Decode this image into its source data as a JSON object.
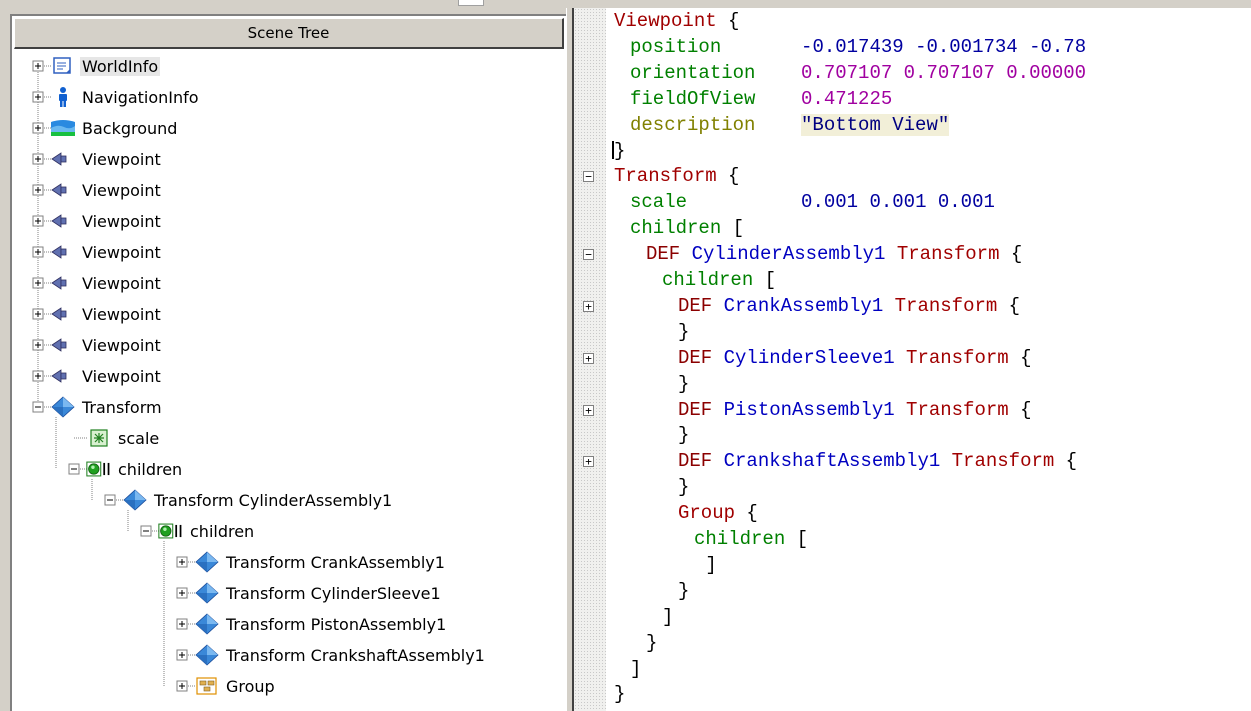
{
  "scene_tree": {
    "title": "Scene Tree",
    "nodes": [
      {
        "label": "WorldInfo",
        "icon": "worldinfo-icon",
        "level": 0,
        "expander": "+",
        "selected": true
      },
      {
        "label": "NavigationInfo",
        "icon": "navigationinfo-icon",
        "level": 0,
        "expander": "+"
      },
      {
        "label": "Background",
        "icon": "background-icon",
        "level": 0,
        "expander": "+"
      },
      {
        "label": "Viewpoint",
        "icon": "viewpoint-icon",
        "level": 0,
        "expander": "+"
      },
      {
        "label": "Viewpoint",
        "icon": "viewpoint-icon",
        "level": 0,
        "expander": "+"
      },
      {
        "label": "Viewpoint",
        "icon": "viewpoint-icon",
        "level": 0,
        "expander": "+"
      },
      {
        "label": "Viewpoint",
        "icon": "viewpoint-icon",
        "level": 0,
        "expander": "+"
      },
      {
        "label": "Viewpoint",
        "icon": "viewpoint-icon",
        "level": 0,
        "expander": "+"
      },
      {
        "label": "Viewpoint",
        "icon": "viewpoint-icon",
        "level": 0,
        "expander": "+"
      },
      {
        "label": "Viewpoint",
        "icon": "viewpoint-icon",
        "level": 0,
        "expander": "+"
      },
      {
        "label": "Viewpoint",
        "icon": "viewpoint-icon",
        "level": 0,
        "expander": "+"
      },
      {
        "label": "Transform",
        "icon": "transform-icon",
        "level": 0,
        "expander": "-"
      },
      {
        "label": "scale",
        "icon": "field-icon",
        "level": 1,
        "expander": ""
      },
      {
        "label": "children",
        "icon": "children-icon",
        "level": 1,
        "expander": "-"
      },
      {
        "label": "Transform CylinderAssembly1",
        "icon": "transform-icon",
        "level": 2,
        "expander": "-"
      },
      {
        "label": "children",
        "icon": "children-icon",
        "level": 3,
        "expander": "-"
      },
      {
        "label": "Transform CrankAssembly1",
        "icon": "transform-icon",
        "level": 4,
        "expander": "+"
      },
      {
        "label": "Transform CylinderSleeve1",
        "icon": "transform-icon",
        "level": 4,
        "expander": "+"
      },
      {
        "label": "Transform PistonAssembly1",
        "icon": "transform-icon",
        "level": 4,
        "expander": "+"
      },
      {
        "label": "Transform CrankshaftAssembly1",
        "icon": "transform-icon",
        "level": 4,
        "expander": "+"
      },
      {
        "label": "Group",
        "icon": "group-icon",
        "level": 4,
        "expander": "+"
      }
    ]
  },
  "editor": {
    "lines": [
      {
        "indent": 0,
        "fold": "",
        "tokens": [
          [
            "node",
            "Viewpoint"
          ],
          [
            "punc",
            " {"
          ]
        ]
      },
      {
        "indent": 1,
        "fold": "",
        "tokens": [
          [
            "field",
            "position"
          ],
          [
            "punc",
            "       "
          ],
          [
            "num",
            "-0.017439 -0.001734 -0.78"
          ]
        ]
      },
      {
        "indent": 1,
        "fold": "",
        "tokens": [
          [
            "field",
            "orientation"
          ],
          [
            "punc",
            "    "
          ],
          [
            "num2",
            "0.707107 0.707107 0.00000"
          ]
        ]
      },
      {
        "indent": 1,
        "fold": "",
        "tokens": [
          [
            "field",
            "fieldOfView"
          ],
          [
            "punc",
            "    "
          ],
          [
            "num2",
            "0.471225"
          ]
        ]
      },
      {
        "indent": 1,
        "fold": "",
        "tokens": [
          [
            "fieldy",
            "description"
          ],
          [
            "punc",
            "    "
          ],
          [
            "str",
            "\"Bottom View\""
          ]
        ]
      },
      {
        "indent": 0,
        "fold": "",
        "tokens": [
          [
            "punc",
            "}"
          ]
        ],
        "caret": true
      },
      {
        "indent": 0,
        "fold": "-",
        "tokens": [
          [
            "node",
            "Transform"
          ],
          [
            "punc",
            " {"
          ]
        ]
      },
      {
        "indent": 1,
        "fold": "",
        "tokens": [
          [
            "field",
            "scale"
          ],
          [
            "punc",
            "          "
          ],
          [
            "num",
            "0.001 0.001 0.001"
          ]
        ]
      },
      {
        "indent": 1,
        "fold": "",
        "tokens": [
          [
            "field",
            "children"
          ],
          [
            "punc",
            " ["
          ]
        ]
      },
      {
        "indent": 2,
        "fold": "-",
        "tokens": [
          [
            "def",
            "DEF "
          ],
          [
            "name",
            "CylinderAssembly1"
          ],
          [
            "punc",
            " "
          ],
          [
            "node",
            "Transform"
          ],
          [
            "punc",
            " {"
          ]
        ]
      },
      {
        "indent": 3,
        "fold": "",
        "tokens": [
          [
            "field",
            "children"
          ],
          [
            "punc",
            " ["
          ]
        ]
      },
      {
        "indent": 4,
        "fold": "+",
        "tokens": [
          [
            "def",
            "DEF "
          ],
          [
            "name",
            "CrankAssembly1"
          ],
          [
            "punc",
            " "
          ],
          [
            "node",
            "Transform"
          ],
          [
            "punc",
            " {"
          ]
        ]
      },
      {
        "indent": 4,
        "fold": "",
        "tokens": [
          [
            "punc",
            "}"
          ]
        ]
      },
      {
        "indent": 4,
        "fold": "+",
        "tokens": [
          [
            "def",
            "DEF "
          ],
          [
            "name",
            "CylinderSleeve1"
          ],
          [
            "punc",
            " "
          ],
          [
            "node",
            "Transform"
          ],
          [
            "punc",
            " {"
          ]
        ]
      },
      {
        "indent": 4,
        "fold": "",
        "tokens": [
          [
            "punc",
            "}"
          ]
        ]
      },
      {
        "indent": 4,
        "fold": "+",
        "tokens": [
          [
            "def",
            "DEF "
          ],
          [
            "name",
            "PistonAssembly1"
          ],
          [
            "punc",
            " "
          ],
          [
            "node",
            "Transform"
          ],
          [
            "punc",
            " {"
          ]
        ]
      },
      {
        "indent": 4,
        "fold": "",
        "tokens": [
          [
            "punc",
            "}"
          ]
        ]
      },
      {
        "indent": 4,
        "fold": "+",
        "tokens": [
          [
            "def",
            "DEF "
          ],
          [
            "name",
            "CrankshaftAssembly1"
          ],
          [
            "punc",
            " "
          ],
          [
            "node",
            "Transform"
          ],
          [
            "punc",
            " {"
          ]
        ]
      },
      {
        "indent": 4,
        "fold": "",
        "tokens": [
          [
            "punc",
            "}"
          ]
        ]
      },
      {
        "indent": 4,
        "fold": "",
        "tokens": [
          [
            "node",
            "Group"
          ],
          [
            "punc",
            " {"
          ]
        ]
      },
      {
        "indent": 5,
        "fold": "",
        "tokens": [
          [
            "field",
            "children"
          ],
          [
            "punc",
            " ["
          ]
        ]
      },
      {
        "indent": 5,
        "fold": "",
        "tokens": [
          [
            "punc",
            " ]"
          ]
        ]
      },
      {
        "indent": 4,
        "fold": "",
        "tokens": [
          [
            "punc",
            "}"
          ]
        ]
      },
      {
        "indent": 3,
        "fold": "",
        "tokens": [
          [
            "punc",
            "]"
          ]
        ]
      },
      {
        "indent": 2,
        "fold": "",
        "tokens": [
          [
            "punc",
            "}"
          ]
        ]
      },
      {
        "indent": 1,
        "fold": "",
        "tokens": [
          [
            "punc",
            "]"
          ]
        ]
      },
      {
        "indent": 0,
        "fold": "",
        "tokens": [
          [
            "punc",
            "}"
          ]
        ]
      }
    ]
  }
}
